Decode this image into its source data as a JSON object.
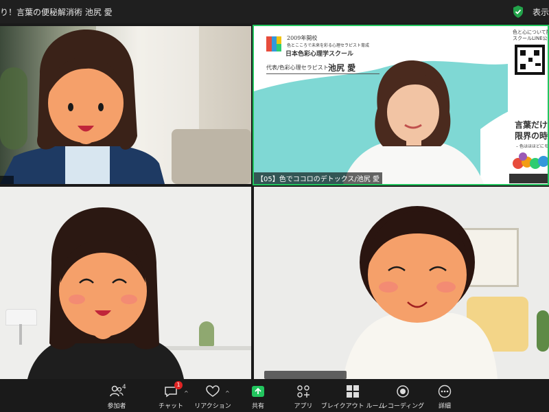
{
  "window": {
    "title": "り！言葉の便秘解消術  池尻 愛",
    "view_label": "表示"
  },
  "tiles": {
    "presenter_name": "【05】色でココロのデトックス/池尻 愛"
  },
  "slide": {
    "established": "2009年開校",
    "tagline": "色とこころで未来を彩る心理セラピスト育成",
    "school_name": "日本色彩心理学スクール",
    "presenter_title": "代表/色彩心理セラピスト",
    "presenter_name": "池尻 愛",
    "line_top1": "色と心について配信",
    "line_top2": "スクールLINE公式",
    "headline1": "言葉だけで",
    "headline2": "限界の時代",
    "subline": "– 色はほほどにモノを"
  },
  "toolbar": {
    "participants_label": "参加者",
    "participants_count": "4",
    "chat_label": "チャット",
    "chat_badge": "1",
    "reaction_label": "リアクション",
    "share_label": "共有",
    "apps_label": "アプリ",
    "breakout_label": "ブレイクアウト ルーム",
    "recording_label": "レコーディング",
    "more_label": "詳細"
  },
  "colors": {
    "share_green": "#22c55e",
    "active_border": "#22c55e",
    "badge_red": "#e02424",
    "avatar_skin": "#f5a06a",
    "avatar_hair": "#2e1a14"
  }
}
